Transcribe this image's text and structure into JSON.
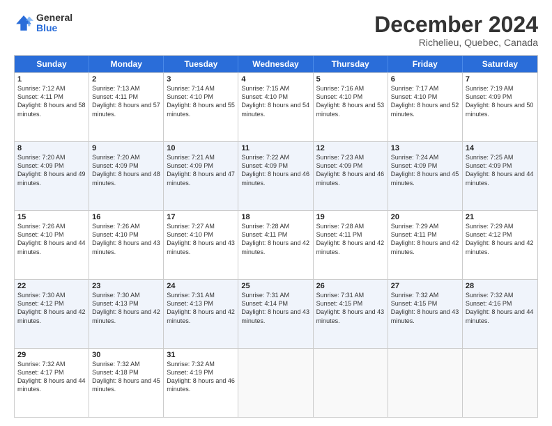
{
  "logo": {
    "general": "General",
    "blue": "Blue"
  },
  "header": {
    "month": "December 2024",
    "location": "Richelieu, Quebec, Canada"
  },
  "days": [
    "Sunday",
    "Monday",
    "Tuesday",
    "Wednesday",
    "Thursday",
    "Friday",
    "Saturday"
  ],
  "weeks": [
    [
      {
        "day": "1",
        "sunrise": "7:12 AM",
        "sunset": "4:11 PM",
        "daylight": "8 hours and 58 minutes."
      },
      {
        "day": "2",
        "sunrise": "7:13 AM",
        "sunset": "4:11 PM",
        "daylight": "8 hours and 57 minutes."
      },
      {
        "day": "3",
        "sunrise": "7:14 AM",
        "sunset": "4:10 PM",
        "daylight": "8 hours and 55 minutes."
      },
      {
        "day": "4",
        "sunrise": "7:15 AM",
        "sunset": "4:10 PM",
        "daylight": "8 hours and 54 minutes."
      },
      {
        "day": "5",
        "sunrise": "7:16 AM",
        "sunset": "4:10 PM",
        "daylight": "8 hours and 53 minutes."
      },
      {
        "day": "6",
        "sunrise": "7:17 AM",
        "sunset": "4:10 PM",
        "daylight": "8 hours and 52 minutes."
      },
      {
        "day": "7",
        "sunrise": "7:19 AM",
        "sunset": "4:09 PM",
        "daylight": "8 hours and 50 minutes."
      }
    ],
    [
      {
        "day": "8",
        "sunrise": "7:20 AM",
        "sunset": "4:09 PM",
        "daylight": "8 hours and 49 minutes."
      },
      {
        "day": "9",
        "sunrise": "7:20 AM",
        "sunset": "4:09 PM",
        "daylight": "8 hours and 48 minutes."
      },
      {
        "day": "10",
        "sunrise": "7:21 AM",
        "sunset": "4:09 PM",
        "daylight": "8 hours and 47 minutes."
      },
      {
        "day": "11",
        "sunrise": "7:22 AM",
        "sunset": "4:09 PM",
        "daylight": "8 hours and 46 minutes."
      },
      {
        "day": "12",
        "sunrise": "7:23 AM",
        "sunset": "4:09 PM",
        "daylight": "8 hours and 46 minutes."
      },
      {
        "day": "13",
        "sunrise": "7:24 AM",
        "sunset": "4:09 PM",
        "daylight": "8 hours and 45 minutes."
      },
      {
        "day": "14",
        "sunrise": "7:25 AM",
        "sunset": "4:09 PM",
        "daylight": "8 hours and 44 minutes."
      }
    ],
    [
      {
        "day": "15",
        "sunrise": "7:26 AM",
        "sunset": "4:10 PM",
        "daylight": "8 hours and 44 minutes."
      },
      {
        "day": "16",
        "sunrise": "7:26 AM",
        "sunset": "4:10 PM",
        "daylight": "8 hours and 43 minutes."
      },
      {
        "day": "17",
        "sunrise": "7:27 AM",
        "sunset": "4:10 PM",
        "daylight": "8 hours and 43 minutes."
      },
      {
        "day": "18",
        "sunrise": "7:28 AM",
        "sunset": "4:11 PM",
        "daylight": "8 hours and 42 minutes."
      },
      {
        "day": "19",
        "sunrise": "7:28 AM",
        "sunset": "4:11 PM",
        "daylight": "8 hours and 42 minutes."
      },
      {
        "day": "20",
        "sunrise": "7:29 AM",
        "sunset": "4:11 PM",
        "daylight": "8 hours and 42 minutes."
      },
      {
        "day": "21",
        "sunrise": "7:29 AM",
        "sunset": "4:12 PM",
        "daylight": "8 hours and 42 minutes."
      }
    ],
    [
      {
        "day": "22",
        "sunrise": "7:30 AM",
        "sunset": "4:12 PM",
        "daylight": "8 hours and 42 minutes."
      },
      {
        "day": "23",
        "sunrise": "7:30 AM",
        "sunset": "4:13 PM",
        "daylight": "8 hours and 42 minutes."
      },
      {
        "day": "24",
        "sunrise": "7:31 AM",
        "sunset": "4:13 PM",
        "daylight": "8 hours and 42 minutes."
      },
      {
        "day": "25",
        "sunrise": "7:31 AM",
        "sunset": "4:14 PM",
        "daylight": "8 hours and 43 minutes."
      },
      {
        "day": "26",
        "sunrise": "7:31 AM",
        "sunset": "4:15 PM",
        "daylight": "8 hours and 43 minutes."
      },
      {
        "day": "27",
        "sunrise": "7:32 AM",
        "sunset": "4:15 PM",
        "daylight": "8 hours and 43 minutes."
      },
      {
        "day": "28",
        "sunrise": "7:32 AM",
        "sunset": "4:16 PM",
        "daylight": "8 hours and 44 minutes."
      }
    ],
    [
      {
        "day": "29",
        "sunrise": "7:32 AM",
        "sunset": "4:17 PM",
        "daylight": "8 hours and 44 minutes."
      },
      {
        "day": "30",
        "sunrise": "7:32 AM",
        "sunset": "4:18 PM",
        "daylight": "8 hours and 45 minutes."
      },
      {
        "day": "31",
        "sunrise": "7:32 AM",
        "sunset": "4:19 PM",
        "daylight": "8 hours and 46 minutes."
      },
      null,
      null,
      null,
      null
    ]
  ],
  "labels": {
    "sunrise": "Sunrise:",
    "sunset": "Sunset:",
    "daylight": "Daylight:"
  }
}
